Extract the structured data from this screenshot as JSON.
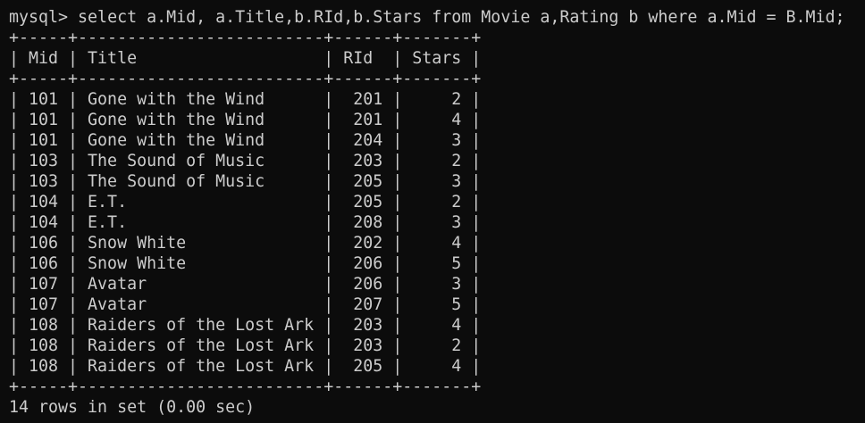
{
  "terminal": {
    "prompt": "mysql> ",
    "command": "select a.Mid, a.Title,b.RId,b.Stars from Movie a,Rating b where a.Mid = B.Mid;",
    "border": "+-----+-------------------------+------+-------+",
    "header": "| Mid | Title                   | RId  | Stars |",
    "rows": [
      "| 101 | Gone with the Wind      |  201 |     2 |",
      "| 101 | Gone with the Wind      |  201 |     4 |",
      "| 101 | Gone with the Wind      |  204 |     3 |",
      "| 103 | The Sound of Music      |  203 |     2 |",
      "| 103 | The Sound of Music      |  205 |     3 |",
      "| 104 | E.T.                    |  205 |     2 |",
      "| 104 | E.T.                    |  208 |     3 |",
      "| 106 | Snow White              |  202 |     4 |",
      "| 106 | Snow White              |  206 |     5 |",
      "| 107 | Avatar                  |  206 |     3 |",
      "| 107 | Avatar                  |  207 |     5 |",
      "| 108 | Raiders of the Lost Ark |  203 |     4 |",
      "| 108 | Raiders of the Lost Ark |  203 |     2 |",
      "| 108 | Raiders of the Lost Ark |  205 |     4 |"
    ],
    "status": "14 rows in set (0.00 sec)"
  }
}
